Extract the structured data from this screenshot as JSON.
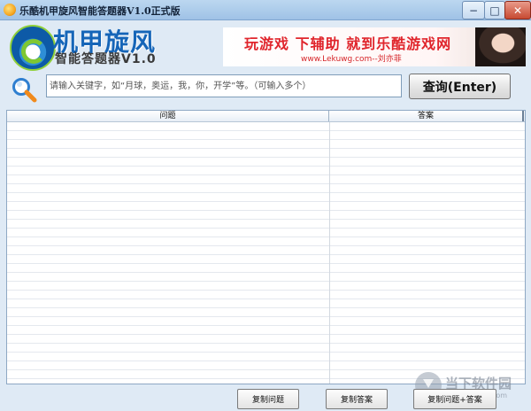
{
  "window": {
    "title": "乐酷机甲旋风智能答题器V1.0正式版",
    "minimize_glyph": "−",
    "maximize_glyph": "□",
    "close_glyph": "✕"
  },
  "logo": {
    "title": "机甲旋风",
    "subtitle": "智能答题器V1.0"
  },
  "banner": {
    "headline": "玩游戏  下辅助  就到乐酷游戏网",
    "url": "www.Lekuwg.com--刘亦菲"
  },
  "search": {
    "value": "",
    "placeholder": "请输入关键字，如“月球，奥运，我，你，开学”等。（可输入多个）",
    "button_label": "查询(Enter)"
  },
  "table": {
    "columns": [
      "问题",
      "答案"
    ],
    "rows": []
  },
  "buttons": {
    "copy_question": "复制问题",
    "copy_answer": "复制答案",
    "copy_both": "复制问题+答案"
  },
  "watermark": {
    "name": "当下软件园",
    "url": "downxia.com"
  },
  "colors": {
    "accent": "#1565b8",
    "banner_red": "#e0252c",
    "logo_green": "#7fc732"
  }
}
